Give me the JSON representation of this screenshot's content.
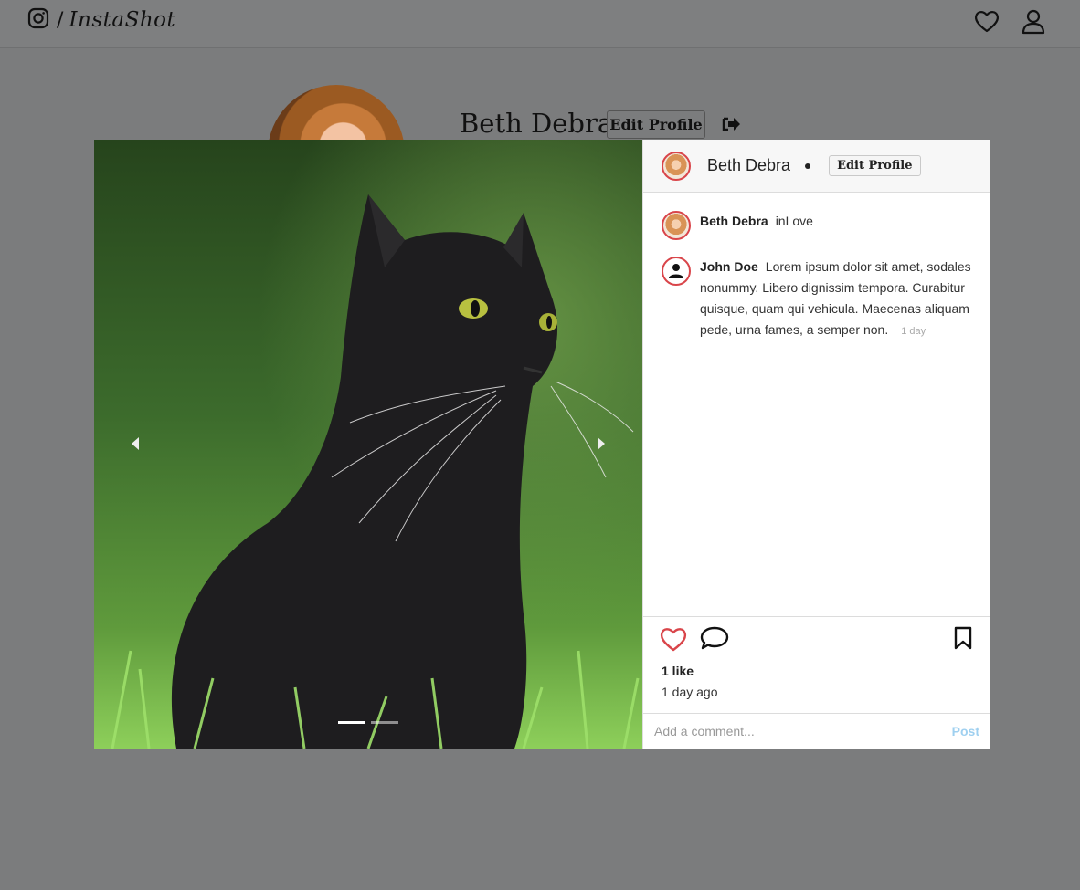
{
  "nav": {
    "separator": "/",
    "brand": "InstaShot",
    "icons": [
      "instagram-icon",
      "heart-icon",
      "user-icon"
    ]
  },
  "profile": {
    "name": "Beth Debra",
    "edit_label": "Edit Profile",
    "logout_icon": "sign-out-icon"
  },
  "post": {
    "carousel": {
      "prev_label": "Previous",
      "next_label": "Next",
      "slide_count": 2,
      "active_slide": 1
    },
    "header": {
      "username": "Beth Debra",
      "edit_label": "Edit Profile"
    },
    "comments": [
      {
        "username": "Beth Debra",
        "text": "inLove",
        "time": ""
      },
      {
        "username": "John Doe",
        "text": "Lorem ipsum dolor sit amet, sodales nonummy. Libero dignissim tempora. Curabitur quisque, quam qui vehicula. Maecenas aliquam pede, urna fames, a semper non.",
        "time": "1 day"
      }
    ],
    "likes": "1 like",
    "posted": "1 day ago",
    "comment_input": {
      "placeholder": "Add a comment...",
      "value": ""
    },
    "post_label": "Post"
  },
  "colors": {
    "overlay": "#7b7c7d",
    "avatar_ring": "#d9454a",
    "like_red": "#d9454a",
    "post_button": "#9fd0f0"
  }
}
